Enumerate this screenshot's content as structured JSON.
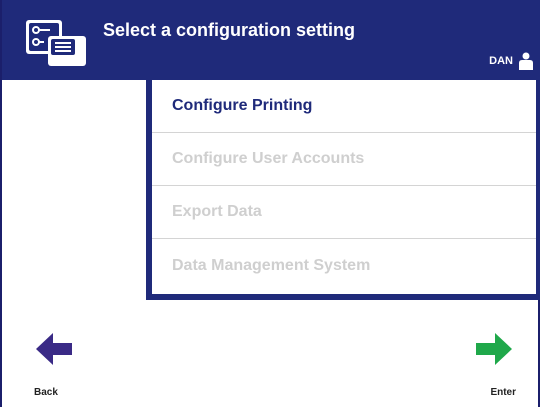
{
  "header": {
    "title": "Select a configuration setting",
    "user_name": "DAN",
    "icon": "configuration-icon",
    "background": "#1f2a7a"
  },
  "menu": {
    "items": [
      {
        "label": "Configure Printing",
        "state": "enabled"
      },
      {
        "label": "Configure User Accounts",
        "state": "disabled"
      },
      {
        "label": "Export Data",
        "state": "disabled"
      },
      {
        "label": "Data Management System",
        "state": "disabled"
      }
    ]
  },
  "nav": {
    "back_label": "Back",
    "back_icon": "left-arrow-icon",
    "back_color": "#3a2a86",
    "enter_label": "Enter",
    "enter_icon": "right-arrow-icon",
    "enter_color": "#1fa84a"
  }
}
